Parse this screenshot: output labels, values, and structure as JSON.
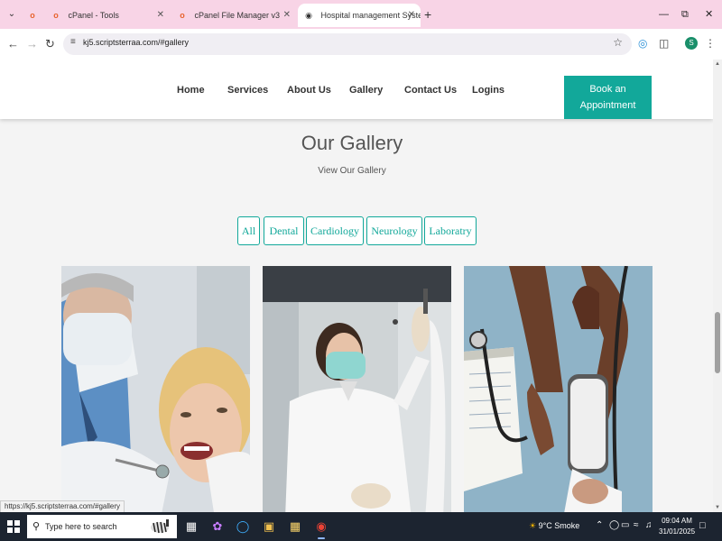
{
  "browser": {
    "tabs": [
      {
        "title": "cPanel - Tools",
        "favicon": "cpanel-icon"
      },
      {
        "title": "cPanel File Manager v3",
        "favicon": "cpanel-icon"
      },
      {
        "title": "Hospital management System",
        "favicon": "globe-icon",
        "active": true
      }
    ],
    "pinned_favicon": "cpanel-icon",
    "url": "kj5.scriptsterraa.com/#gallery",
    "status_url": "https://kj5.scriptsterraa.com/#gallery",
    "profile_initial": "S"
  },
  "site": {
    "nav": [
      "Home",
      "Services",
      "About Us",
      "Gallery",
      "Contact Us",
      "Logins"
    ],
    "cta_line1": "Book an",
    "cta_line2": "Appointment",
    "accent": "#12a89a"
  },
  "gallery": {
    "title": "Our Gallery",
    "subtitle": "View Our Gallery",
    "filters": [
      "All",
      "Dental",
      "Cardiology",
      "Neurology",
      "Laboratry"
    ],
    "images": [
      {
        "subject": "dentist-examining-patient"
      },
      {
        "subject": "lab-technician-holding-sample"
      },
      {
        "subject": "blood-pressure-measurement"
      }
    ]
  },
  "taskbar": {
    "search_placeholder": "Type here to search",
    "weather": "9°C  Smoke",
    "time": "09:04 AM",
    "date": "31/01/2025"
  }
}
